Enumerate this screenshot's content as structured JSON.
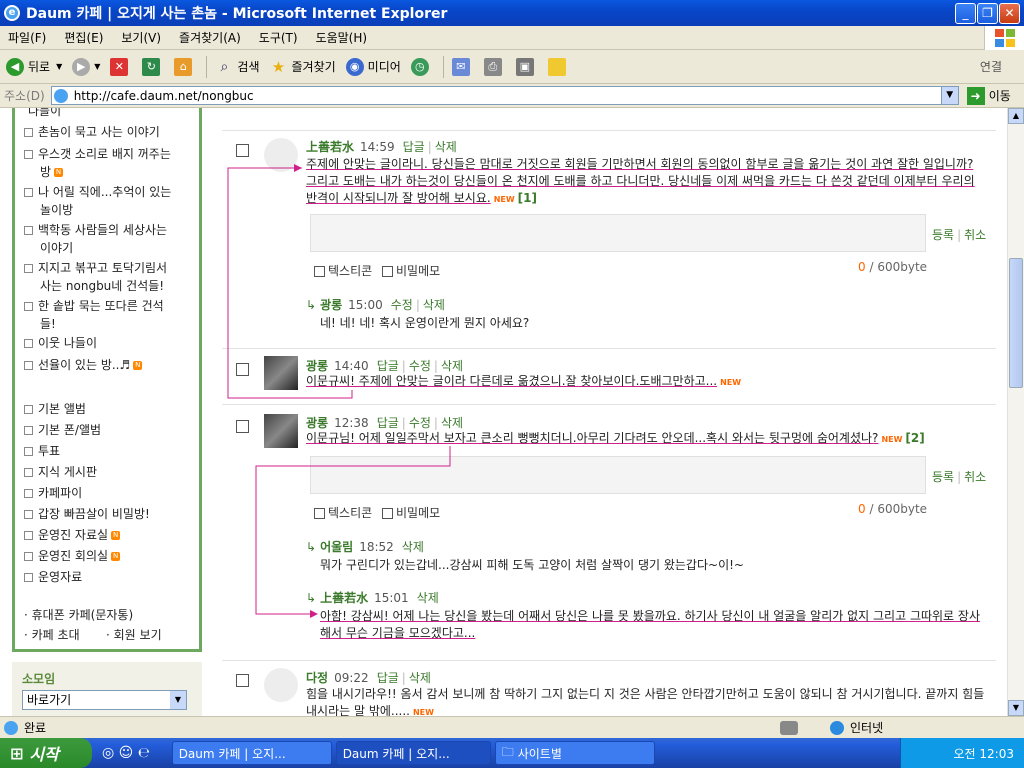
{
  "window": {
    "title": "Daum 카페 | 오지게 사는 촌놈 - Microsoft Internet Explorer"
  },
  "menu": [
    "파일(F)",
    "편집(E)",
    "보기(V)",
    "즐겨찾기(A)",
    "도구(T)",
    "도움말(H)"
  ],
  "toolbar": {
    "back": "뒤로",
    "search": "검색",
    "favorites": "즐겨찾기",
    "media": "미디어",
    "links": "연결"
  },
  "address": {
    "label": "주소(D)",
    "url": "http://cafe.daum.net/nongbuc",
    "go": "이동"
  },
  "sidebar": {
    "items": [
      {
        "label": "나들이",
        "new": false
      },
      {
        "label": "촌놈이 묵고 사는 이야기",
        "new": false
      },
      {
        "label": "우스갯 소리로 배지 꺼주는",
        "label2": "방",
        "new": true
      },
      {
        "label": "나 어릴 직에...추억이 있는",
        "label2": "놀이방",
        "new": false
      },
      {
        "label": "백학동 사람들의 세상사는",
        "label2": "이야기",
        "new": false
      },
      {
        "label": "지지고 볶꾸고 토닥기림서",
        "label2": "사는 nongbu네 건석들!",
        "new": false
      },
      {
        "label": "한 솥밥 묵는 또다른 건석",
        "label2": "들!",
        "new": false
      },
      {
        "label": "이웃 나들이",
        "new": false
      },
      {
        "label": "선율이 있는 방..♬",
        "new": true
      }
    ],
    "items2": [
      {
        "label": "기본 앨범",
        "new": false
      },
      {
        "label": "기본 폰/앨범",
        "new": false
      },
      {
        "label": "투표",
        "new": false
      },
      {
        "label": "지식 게시판",
        "new": false
      },
      {
        "label": "카페파이",
        "new": false
      },
      {
        "label": "갑장 빠끔살이 비밀방!",
        "new": false
      },
      {
        "label": "운영진 자료실",
        "new": true
      },
      {
        "label": "운영진 회의실",
        "new": true
      },
      {
        "label": "운영자료",
        "new": false
      }
    ],
    "phone": "휴대폰 카페(문자통)",
    "invite": "카페 초대",
    "members": "회원 보기",
    "somoim": "소모임",
    "goto": "바로가기"
  },
  "common": {
    "reply": "답글",
    "delete": "삭제",
    "edit": "수정",
    "register": "등록",
    "cancel": "취소",
    "emoticon": "텍스티콘",
    "secret": "비밀메모",
    "byte_zero": "0",
    "byte_max": "/ 600byte",
    "new": "NEW"
  },
  "comments": [
    {
      "name": "上善若水",
      "time": "14:59",
      "text": "주제에 안맞는 글이라니. 당신들은 맘대로 거짓으로 회원들 기만하면서 회원의 동의없이 함부로 글을 옮기는 것이 과연 잘한 일입니까? 그리고 도배는 내가 하는것이 당신들이 온 천지에 도배를 하고 다니더만. 당신네들 이제 써먹을 카드는 다 쓴것 같던데 이제부터 우리의 반격이 시작되니까 잘 방어해 보시요.",
      "count": "[1]",
      "sub": [
        {
          "name": "광롱",
          "time": "15:00",
          "text": "네! 네! 네! 혹시 운영이란게 뭔지 아세요?"
        }
      ]
    },
    {
      "name": "광롱",
      "time": "14:40",
      "text": "이문규씨! 주제에 안맞는 글이라 다른데로 옮겼으니.잘 찾아보이다.도배그만하고..."
    },
    {
      "name": "광롱",
      "time": "12:38",
      "text": "이문규님! 어제 일일주막서 보자고 큰소리 뻥뻥치더니.아무리 기다려도 안오데...혹시 와서는 뒷구멍에 숨어계셨나?",
      "count": "[2]",
      "sub": [
        {
          "name": "어울림",
          "time": "18:52",
          "text": "뭐가 구린디가 있는갑네...강삼씨 피해 도독 고양이 처럼 살짝이 댕기 왔는갑다~이!~"
        },
        {
          "name": "上善若水",
          "time": "15:01",
          "text": "아함! 강삼씨! 어제 나는 당신을 봤는데 어째서 당신은 나를 못 봤을까요. 하기사 당신이 내 얼굴을 알리가 없지 그리고 그따위로 장사해서 무슨 기금을 모으겠다고..."
        }
      ]
    },
    {
      "name": "다정",
      "time": "09:22",
      "text": "힘을 내시기라우!! 옴서 감서 보니께 참 딱하기 그지 없는디 지 것은 사람은 안타깝기만허고 도움이 않되니 참 거시기헙니다. 끝까지 힘들내시라는 말 밖에....."
    }
  ],
  "status": {
    "done": "완료",
    "zone": "인터넷"
  },
  "taskbar": {
    "start": "시작",
    "tasks": [
      "Daum 카페 | 오지...",
      "Daum 카페 | 오지...",
      "사이트별"
    ],
    "clock": "오전 12:03"
  }
}
